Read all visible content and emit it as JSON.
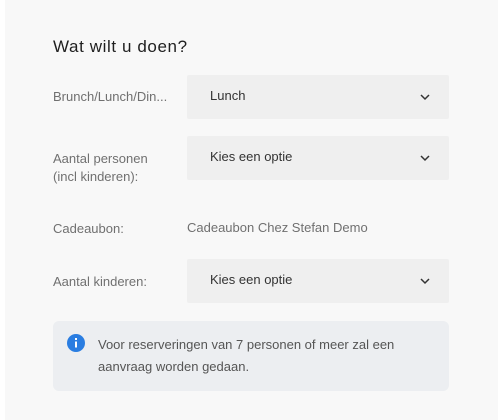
{
  "title": "Wat wilt u doen?",
  "meal": {
    "label": "Brunch/Lunch/Din...",
    "value": "Lunch"
  },
  "persons": {
    "label": "Aantal personen (incl kinderen):",
    "value": "Kies een optie"
  },
  "voucher": {
    "label": "Cadeaubon:",
    "value": "Cadeaubon Chez Stefan Demo"
  },
  "children": {
    "label": "Aantal kinderen:",
    "value": "Kies een optie"
  },
  "info": {
    "icon": "info-icon",
    "text": "Voor reserveringen van 7 personen of meer zal een aanvraag worden gedaan."
  },
  "colors": {
    "info_icon": "#2a7de1",
    "select_bg": "#efefef"
  }
}
